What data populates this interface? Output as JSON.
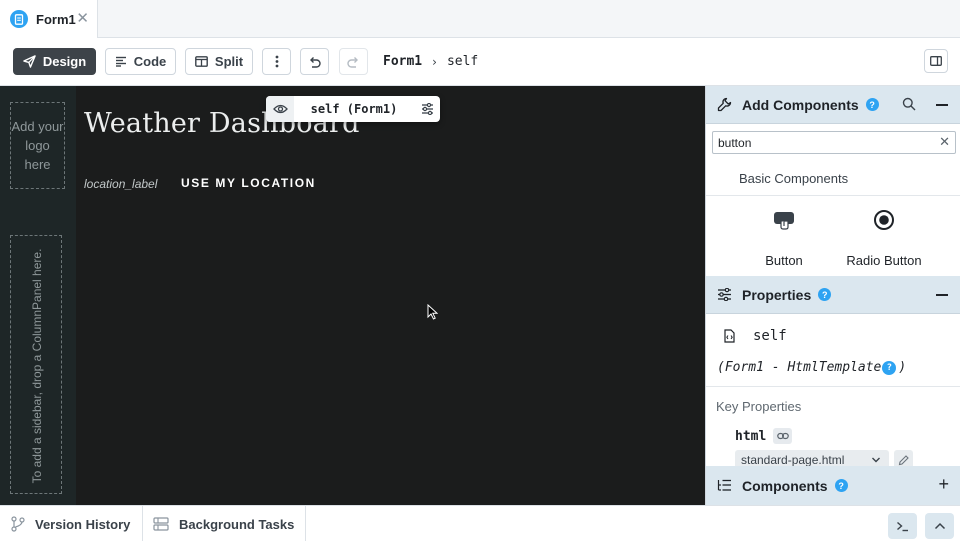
{
  "tab": {
    "label": "Form1",
    "close": "✕"
  },
  "toolbar": {
    "design": "Design",
    "code": "Code",
    "split": "Split",
    "breadcrumb_form": "Form1",
    "breadcrumb_sep": "›",
    "breadcrumb_self": "self"
  },
  "canvas": {
    "logo_placeholder": "Add your logo here",
    "sidebar_placeholder": "To add a sidebar, drop a ColumnPanel here.",
    "title": "Weather Dashboard",
    "location_label": "location_label",
    "location_button": "USE MY LOCATION",
    "selection_label": "self (Form1)"
  },
  "add_components": {
    "title": "Add Components",
    "search_value": "button",
    "search_clear": "✕",
    "category": "Basic Components",
    "items": [
      {
        "label": "Button",
        "icon": "button-icon"
      },
      {
        "label": "Radio Button",
        "icon": "radio-button-icon"
      }
    ]
  },
  "properties": {
    "title": "Properties",
    "component_name": "self",
    "component_type_prefix": "(Form1 - HtmlTemplate",
    "component_type_suffix": ")",
    "key_properties": "Key Properties",
    "html_label": "html",
    "html_value": "standard-page.html"
  },
  "components_panel": {
    "title": "Components"
  },
  "help_glyph": "?",
  "bottom": {
    "version_history": "Version History",
    "background_tasks": "Background Tasks"
  },
  "colors": {
    "accent": "#2ea3f2",
    "canvas_bg": "#1b1c1c",
    "section_bg": "#dbe7ef",
    "primary_button": "#3d4349"
  }
}
